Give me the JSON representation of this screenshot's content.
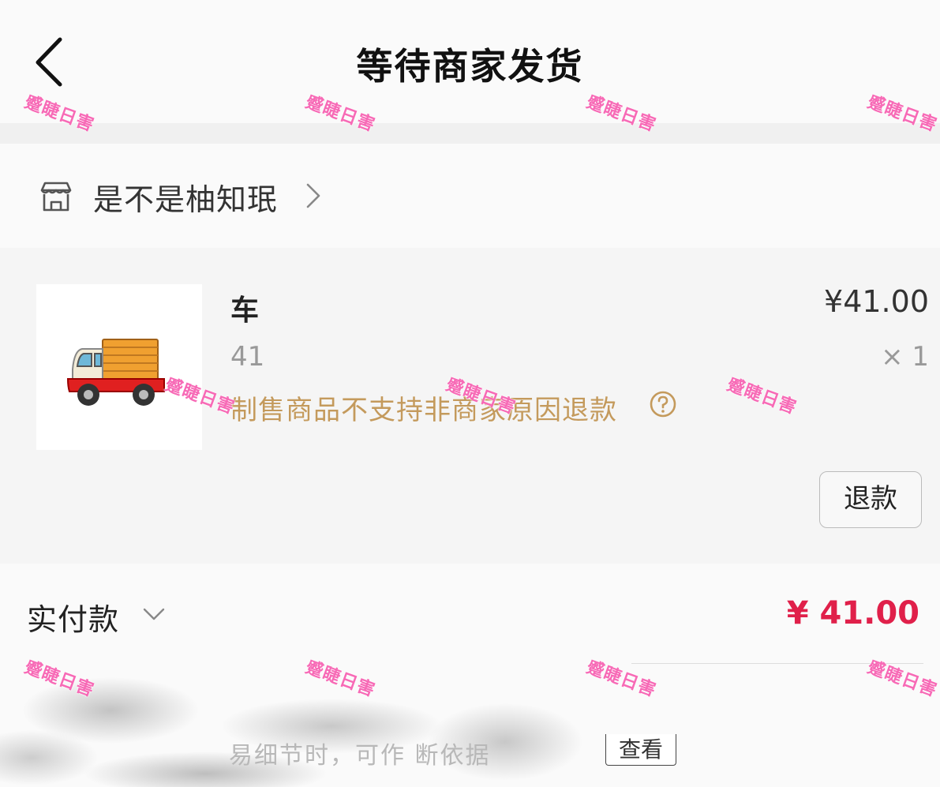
{
  "header": {
    "title": "等待商家发货"
  },
  "shop": {
    "name": "是不是柚知珉"
  },
  "product": {
    "name": "车",
    "price": "¥41.00",
    "spec": "41",
    "quantity": "× 1",
    "notice": "制售商品不支持非商家原因退款",
    "refund_label": "退款"
  },
  "payment": {
    "label": "实付款",
    "amount": "¥ 41.00",
    "obscured_text": "易细节时，可作   断依据",
    "view_label": "查看"
  },
  "watermark": {
    "text": "蹙睫日害"
  },
  "colors": {
    "accent_price": "#e0204a",
    "notice": "#c49a5c",
    "watermark": "#f76ab6"
  }
}
